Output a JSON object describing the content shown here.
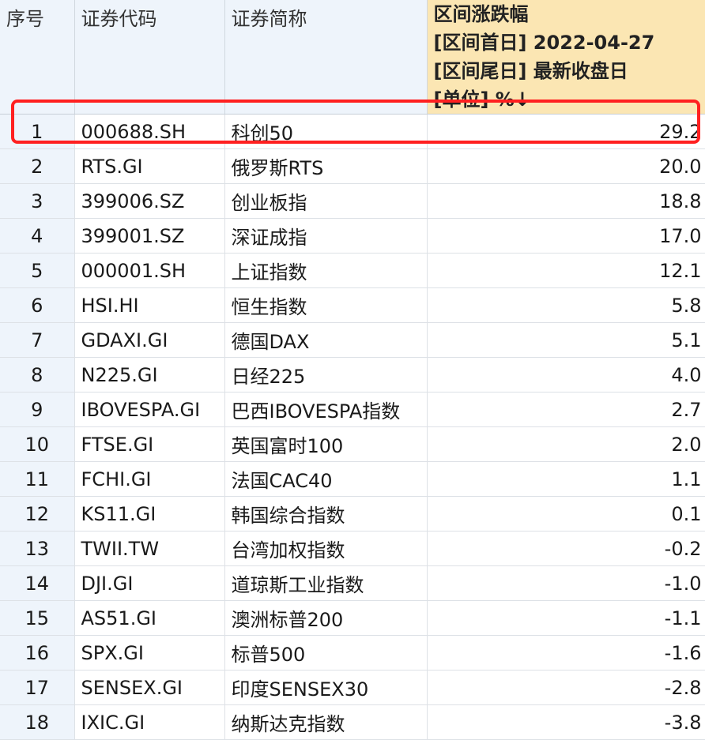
{
  "table": {
    "headers": {
      "index": "序号",
      "code": "证券代码",
      "name": "证券简称",
      "change_lines": [
        "区间涨跌幅",
        "[区间首日] 2022-04-27",
        "[区间尾日] 最新收盘日",
        "[单位] %↓"
      ]
    },
    "rows": [
      {
        "index": "1",
        "code": "000688.SH",
        "name": "科创50",
        "change": "29.2"
      },
      {
        "index": "2",
        "code": "RTS.GI",
        "name": "俄罗斯RTS",
        "change": "20.0"
      },
      {
        "index": "3",
        "code": "399006.SZ",
        "name": "创业板指",
        "change": "18.8"
      },
      {
        "index": "4",
        "code": "399001.SZ",
        "name": "深证成指",
        "change": "17.0"
      },
      {
        "index": "5",
        "code": "000001.SH",
        "name": "上证指数",
        "change": "12.1"
      },
      {
        "index": "6",
        "code": "HSI.HI",
        "name": "恒生指数",
        "change": "5.8"
      },
      {
        "index": "7",
        "code": "GDAXI.GI",
        "name": "德国DAX",
        "change": "5.1"
      },
      {
        "index": "8",
        "code": "N225.GI",
        "name": "日经225",
        "change": "4.0"
      },
      {
        "index": "9",
        "code": "IBOVESPA.GI",
        "name": "巴西IBOVESPA指数",
        "change": "2.7"
      },
      {
        "index": "10",
        "code": "FTSE.GI",
        "name": "英国富时100",
        "change": "2.0"
      },
      {
        "index": "11",
        "code": "FCHI.GI",
        "name": "法国CAC40",
        "change": "1.1"
      },
      {
        "index": "12",
        "code": "KS11.GI",
        "name": "韩国综合指数",
        "change": "0.1"
      },
      {
        "index": "13",
        "code": "TWII.TW",
        "name": "台湾加权指数",
        "change": "-0.2"
      },
      {
        "index": "14",
        "code": "DJI.GI",
        "name": "道琼斯工业指数",
        "change": "-1.0"
      },
      {
        "index": "15",
        "code": "AS51.GI",
        "name": "澳洲标普200",
        "change": "-1.1"
      },
      {
        "index": "16",
        "code": "SPX.GI",
        "name": "标普500",
        "change": "-1.6"
      },
      {
        "index": "17",
        "code": "SENSEX.GI",
        "name": "印度SENSEX30",
        "change": "-2.8"
      },
      {
        "index": "18",
        "code": "IXIC.GI",
        "name": "纳斯达克指数",
        "change": "-3.8"
      }
    ]
  },
  "highlight": {
    "row_index": "1",
    "color": "#ff2020"
  },
  "colors": {
    "header_bg": "#eef4fb",
    "sorted_header_bg": "#fbe6b3"
  }
}
